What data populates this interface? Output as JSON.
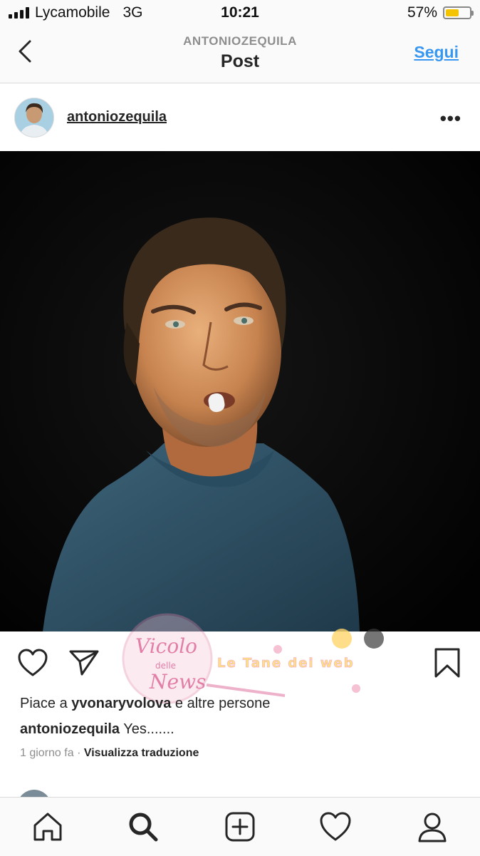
{
  "status_bar": {
    "carrier": "Lycamobile",
    "network": "3G",
    "time": "10:21",
    "battery_text": "57%",
    "battery_level": 0.57,
    "battery_color": "#f5c400"
  },
  "nav": {
    "subtitle": "ANTONIOZEQUILA",
    "title": "Post",
    "follow_label": "Segui",
    "back_icon": "chevron-left-icon",
    "accent": "#3897f0"
  },
  "post": {
    "username": "antoniozequila",
    "more_icon": "more-icon",
    "likes_prefix": "Piace a",
    "likes_user": "yvonaryvolova",
    "likes_suffix": "e altre persone",
    "caption_user": "antoniozequila",
    "caption_text": "Yes.......",
    "time_ago": "1 giorno fa",
    "separator": "·",
    "translate_label": "Visualizza traduzione"
  },
  "actions": {
    "like_icon": "heart-icon",
    "share_icon": "send-icon",
    "save_icon": "bookmark-icon"
  },
  "watermark": {
    "logo_line1": "Vicolo",
    "logo_line2": "delle",
    "logo_line3": "News",
    "banner": "Le Tane dei web"
  },
  "tab_bar": {
    "items": [
      "home-icon",
      "search-icon",
      "add-post-icon",
      "activity-heart-icon",
      "profile-icon"
    ]
  }
}
